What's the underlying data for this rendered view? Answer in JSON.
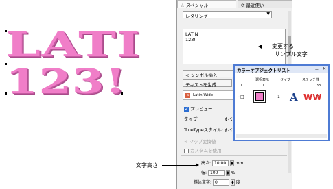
{
  "canvas": {
    "line1": "LATI",
    "line2": "123!"
  },
  "panel": {
    "tab_special": "☆ スペシャル",
    "tab_recent": "⟳ 最近使い",
    "select_value": "レタリング",
    "text_lines": [
      "LATIN",
      "123!"
    ],
    "btn_symbol": "シンボル挿入",
    "btn_generate": "テキストを生成",
    "font_name": "Latin Wide",
    "preview_label": "プレビュー",
    "type_label": "タイプ:",
    "type_value": "すべて",
    "truetype_label": "TrueTypeスタイル:",
    "truetype_value": "すべて",
    "auto_convert_label": "マップ変換値",
    "custom_label": "カスタムを使用",
    "height_label": "高さ:",
    "height_value": "10.00",
    "height_unit": "mm",
    "width_label": "幅:",
    "width_value": "100",
    "width_unit": "%",
    "slant_label": "斜体文字:",
    "slant_value": "0",
    "slant_unit": "度"
  },
  "color_list": {
    "title": "カラーオブジェクトリスト",
    "pin": "⊥",
    "close": "✕",
    "columns": [
      "選択表示",
      "タイプ",
      "ステッチ数"
    ],
    "num1": "1",
    "num1b": "1",
    "stitch1": "1.33",
    "stitch2": "133",
    "row_num": "1",
    "letter_icon": "A",
    "zigzag_icon": "WW"
  },
  "annotations": {
    "sample_text_1": "変更する",
    "sample_text_2": "サンプル文字",
    "text_height": "文字高さ"
  },
  "colors": {
    "thread_pink": "#f07ec8",
    "frame_blue": "#4e7bd4"
  }
}
